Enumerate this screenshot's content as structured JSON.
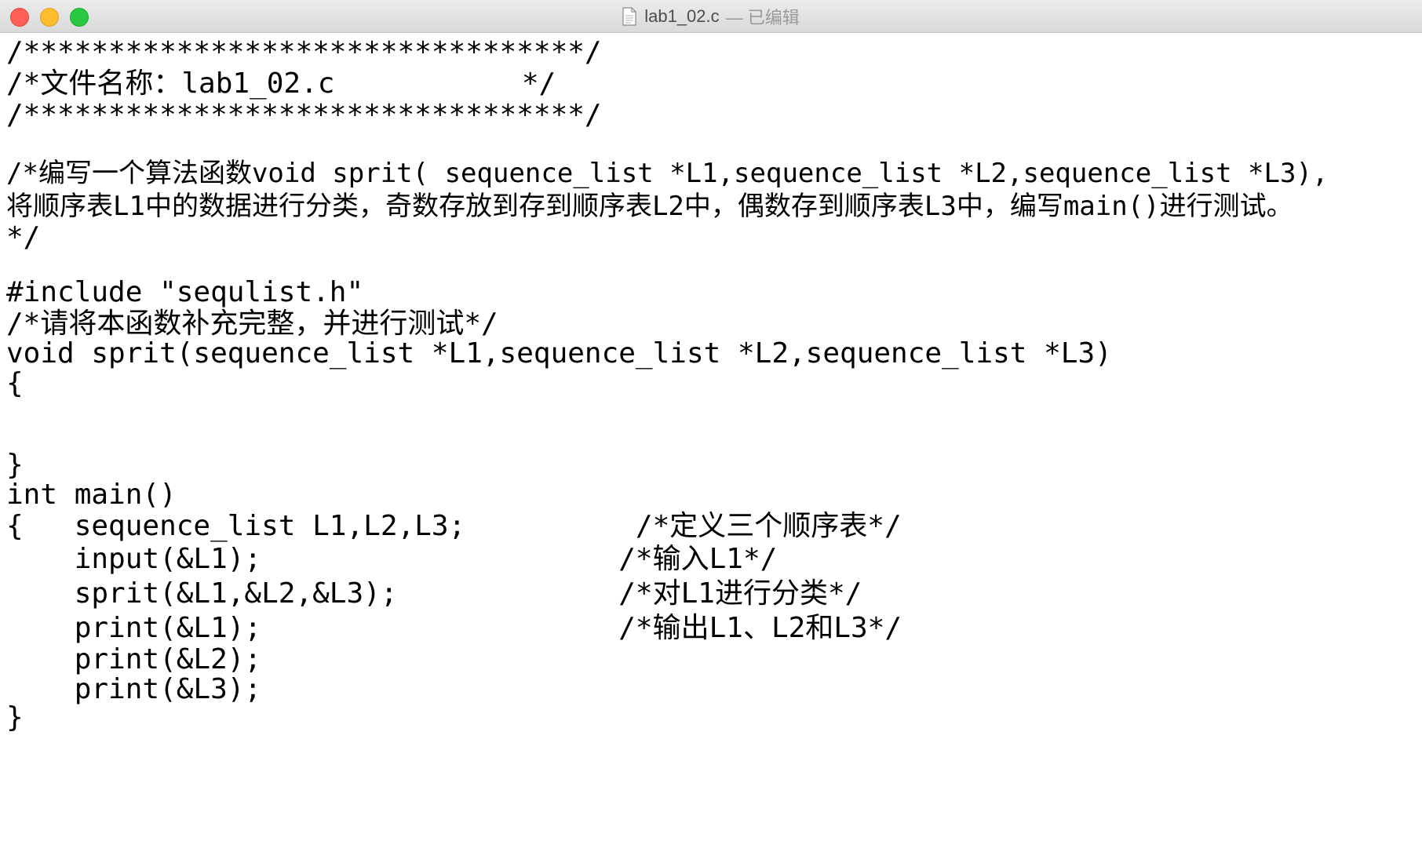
{
  "window": {
    "title": "lab1_02.c",
    "status": "— 已编辑",
    "icons": {
      "close": "close-traffic-light",
      "minimize": "minimize-traffic-light",
      "zoom": "zoom-traffic-light",
      "document": "document-icon"
    },
    "colors": {
      "close": "#fe5f57",
      "minimize": "#febc2e",
      "zoom": "#28c840"
    }
  },
  "editor": {
    "lines": [
      "/*********************************/",
      "/*文件名称：lab1_02.c           */",
      "/*********************************/",
      "",
      "/*编写一个算法函数void sprit( sequence_list *L1,sequence_list *L2,sequence_list *L3),",
      "将顺序表L1中的数据进行分类，奇数存放到存到顺序表L2中，偶数存到顺序表L3中，编写main()进行测试。",
      "*/",
      "",
      "#include \"sequlist.h\"",
      "/*请将本函数补充完整，并进行测试*/",
      "void sprit(sequence_list *L1,sequence_list *L2,sequence_list *L3)",
      "{",
      "",
      "",
      "}",
      "int main()",
      "{   sequence_list L1,L2,L3;          /*定义三个顺序表*/",
      "    input(&L1);                     /*输入L1*/",
      "    sprit(&L1,&L2,&L3);             /*对L1进行分类*/",
      "    print(&L1);                     /*输出L1、L2和L3*/",
      "    print(&L2);",
      "    print(&L3);",
      "}"
    ]
  }
}
